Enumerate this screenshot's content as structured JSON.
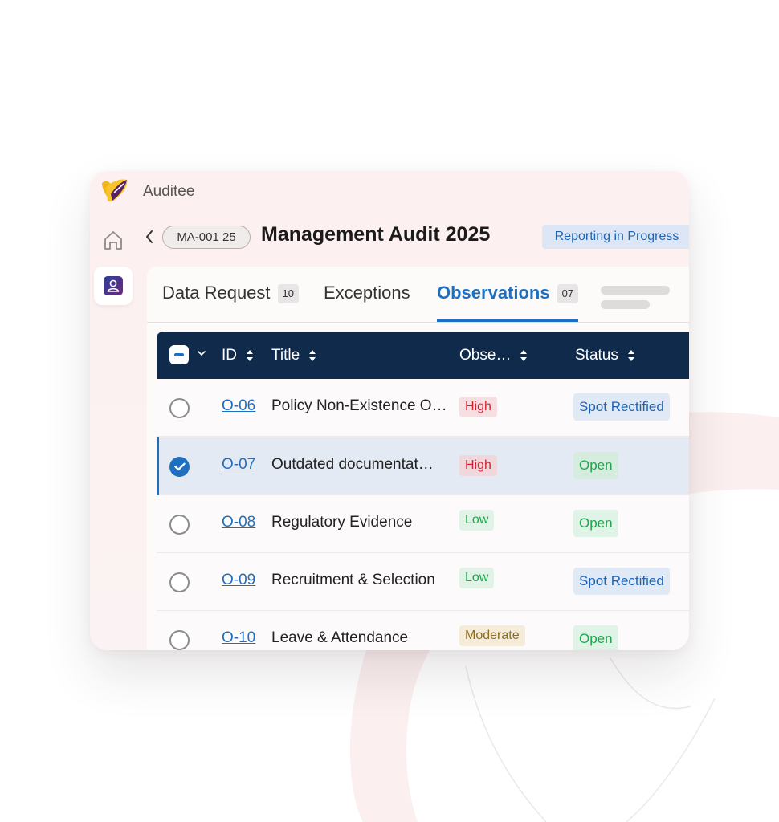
{
  "app": {
    "name": "Auditee"
  },
  "header": {
    "audit_id": "MA-001 25",
    "title": "Management Audit 2025",
    "status": "Reporting in Progress"
  },
  "tabs": [
    {
      "label": "Data Request",
      "count": "10"
    },
    {
      "label": "Exceptions"
    },
    {
      "label": "Observations",
      "count": "07",
      "active": true
    }
  ],
  "table": {
    "columns": [
      "ID",
      "Title",
      "Obse…",
      "Status"
    ],
    "rows": [
      {
        "id": "O-06",
        "title": "Policy Non-Existence O…",
        "severity": "High",
        "status": "Spot Rectified",
        "selected": false
      },
      {
        "id": "O-07",
        "title": "Outdated documentat…",
        "severity": "High",
        "status": "Open",
        "selected": true
      },
      {
        "id": "O-08",
        "title": "Regulatory Evidence",
        "severity": "Low",
        "status": "Open",
        "selected": false
      },
      {
        "id": "O-09",
        "title": "Recruitment & Selection",
        "severity": "Low",
        "status": "Spot Rectified",
        "selected": false
      },
      {
        "id": "O-10",
        "title": "Leave & Attendance",
        "severity": "Moderate",
        "status": "Open",
        "selected": false
      }
    ]
  },
  "colors": {
    "accent": "#1f6fc0",
    "header_bg": "#102a4c",
    "high": "#d4202f",
    "low": "#1ea64b",
    "moderate": "#8d6e20"
  },
  "icons": {
    "logo": "auditee-logo-icon",
    "home": "home-icon",
    "user": "user-profile-icon",
    "back": "chevron-left-icon",
    "sort": "sort-icon",
    "dropdown": "chevron-down-icon",
    "check": "checkmark-icon"
  }
}
